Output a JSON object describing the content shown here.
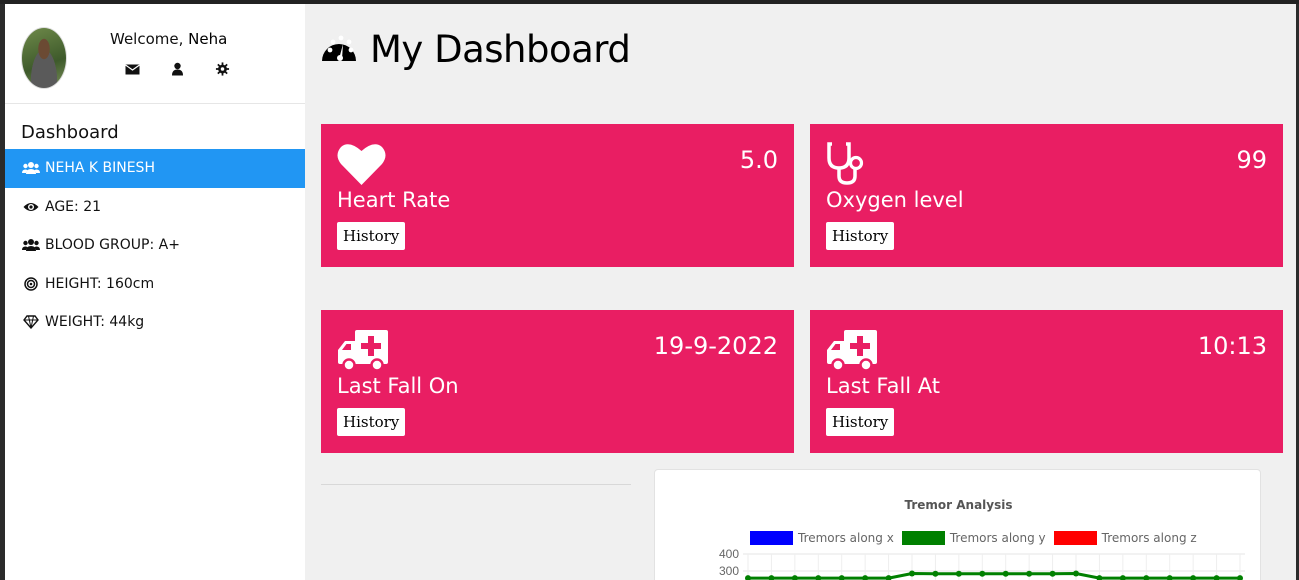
{
  "sidebar": {
    "welcome_prefix": "Welcome, ",
    "username": "Neha",
    "icons": [
      "envelope-icon",
      "user-icon",
      "gear-icon"
    ],
    "section_title": "Dashboard",
    "items": [
      {
        "label": "NEHA K BINESH",
        "icon": "users-icon",
        "active": true
      },
      {
        "label": "AGE: 21",
        "icon": "eye-icon",
        "active": false
      },
      {
        "label": "BLOOD GROUP: A+",
        "icon": "users-icon",
        "active": false
      },
      {
        "label": "HEIGHT: 160cm",
        "icon": "bullseye-icon",
        "active": false
      },
      {
        "label": "WEIGHT: 44kg",
        "icon": "diamond-icon",
        "active": false
      }
    ]
  },
  "header": {
    "title": "My Dashboard",
    "icon": "dashboard-gauge-icon"
  },
  "cards": [
    {
      "label": "Heart Rate",
      "value": "5.0",
      "icon": "heart-icon",
      "button": "History"
    },
    {
      "label": "Oxygen level",
      "value": "99",
      "icon": "stethoscope-icon",
      "button": "History"
    },
    {
      "label": "Last Fall On",
      "value": "19-9-2022",
      "icon": "ambulance-icon",
      "button": "History"
    },
    {
      "label": "Last Fall At",
      "value": "10:13",
      "icon": "ambulance-icon",
      "button": "History"
    }
  ],
  "colors": {
    "card_bg": "#e91e63",
    "active_item": "#2196f3",
    "series_x": "#0000ff",
    "series_y": "#008000",
    "series_z": "#ff0000"
  },
  "chart_data": {
    "type": "line",
    "title": "Tremor Analysis",
    "legend_placement": "top",
    "grid": true,
    "yticks_visible": [
      "400",
      "300"
    ],
    "series": [
      {
        "name": "Tremors along x",
        "color": "#0000ff",
        "values": []
      },
      {
        "name": "Tremors along y",
        "color": "#008000",
        "values": [
          258,
          258,
          258,
          258,
          258,
          258,
          258,
          285,
          284,
          284,
          284,
          284,
          284,
          284,
          285,
          258,
          258,
          258,
          258,
          258,
          258,
          258
        ]
      },
      {
        "name": "Tremors along z",
        "color": "#ff0000",
        "values": []
      }
    ]
  }
}
